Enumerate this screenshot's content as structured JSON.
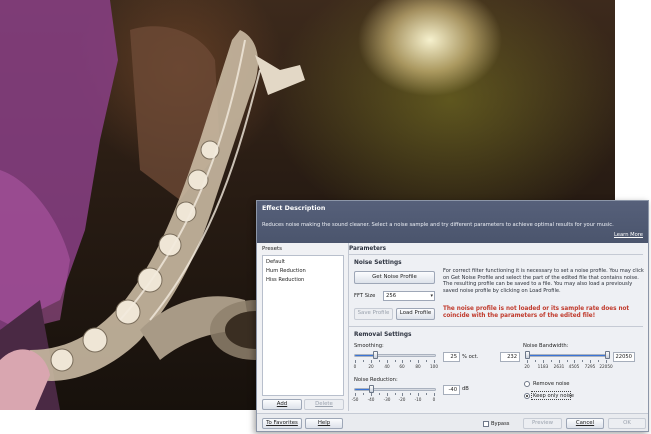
{
  "dialog": {
    "title": "Effect Description",
    "description": "Reduces noise making the sound cleaner. Select a noise sample and try different parameters to achieve optimal results for your music.",
    "learn_more": "Learn More"
  },
  "presets": {
    "label": "Presets",
    "items": [
      "Default",
      "Hum Reduction",
      "Hiss Reduction"
    ],
    "add_label": "Add",
    "delete_label": "Delete"
  },
  "parameters": {
    "label": "Parameters",
    "noise_settings": {
      "title": "Noise Settings",
      "get_noise_profile": "Get Noise Profile",
      "fft_size_label": "FFT Size",
      "fft_size_value": "256",
      "save_profile": "Save Profile",
      "load_profile": "Load Profile",
      "info": "For correct filter functioning it is necessary to set a noise profile. You may click on Get Noise Profile and select the part of the edited file that contains noise. The resulting profile can be saved to a file. You may also load a previously saved noise profile by clicking on Load Profile.",
      "warning": "The noise profile is not loaded or its sample rate does not coincide with the parameters of the edited file!"
    },
    "removal_settings": {
      "title": "Removal Settings",
      "smoothing": {
        "label": "Smoothing:",
        "value": "25",
        "unit": "% oct.",
        "level": 0.25,
        "ticks": [
          "0",
          "20",
          "40",
          "60",
          "80",
          "100"
        ]
      },
      "noise_reduction": {
        "label": "Noise Reduction:",
        "value": "-40",
        "unit": "dB",
        "level": -40,
        "ticks": [
          "-50",
          "-40",
          "-30",
          "-20",
          "-10",
          "0"
        ]
      },
      "noise_bandwidth": {
        "label": "Noise Bandwidth:",
        "low_value": "232",
        "high_value": "22050",
        "ticks": [
          "20",
          "1183",
          "2631",
          "4505",
          "7295",
          "22050"
        ]
      },
      "mode_options": [
        "Remove noise",
        "Keep only noise"
      ],
      "selected_mode": "Keep only noise"
    }
  },
  "footer": {
    "to_favorites": "To Favorites",
    "help": "Help",
    "bypass": "Bypass",
    "preview": "Preview",
    "cancel": "Cancel",
    "ok": "OK"
  },
  "colors": {
    "description_bar": "#4b556d",
    "warning_text": "#c0392b",
    "slider_fill": "#3a74d6"
  }
}
